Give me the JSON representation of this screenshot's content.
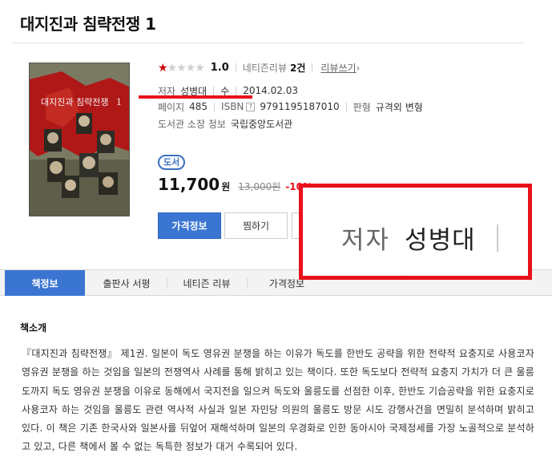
{
  "book": {
    "title": "대지진과 침략전쟁 1"
  },
  "rating": {
    "score": "1.0",
    "stars_filled_fraction": 0.1,
    "review_label": "네티즌리뷰",
    "review_count": "2건",
    "review_write": "리뷰쓰기",
    "chevron": "›"
  },
  "details": {
    "author_label": "저자",
    "author": "성병대",
    "role": "수",
    "date": "2014.02.03",
    "page_label": "페이지",
    "pages": "485",
    "isbn_label": "ISBN",
    "isbn_help": "?",
    "isbn": "9791195187010",
    "format_label": "판형",
    "format": "규격외 변형",
    "library_label": "도서관 소장 정보",
    "library": "국립중앙도서관"
  },
  "price": {
    "badge": "도서",
    "amount": "11,700",
    "won": "원",
    "original": "13,000원",
    "discount": "-10%"
  },
  "buttons": {
    "price_info": "가격정보",
    "wishlist": "찜하기"
  },
  "zoom": {
    "label": "저자",
    "value": "성병대",
    "next_line": "페이지 485"
  },
  "tabs": [
    {
      "label": "책정보"
    },
    {
      "label": "출판사 서평"
    },
    {
      "label": "네티즌 리뷰"
    },
    {
      "label": "가격정보"
    }
  ],
  "section": {
    "title": "책소개",
    "body": "『대지진과 침략전쟁』 제1권. 일본이 독도 영유권 분쟁을 하는 이유가 독도를 한반도 공략을 위한 전략적 요충지로 사용코자 영유권 분쟁을 하는 것임을 일본의 전쟁역사 사례를 통해 밝히고 있는 책이다. 또한 독도보다 전략적 요충지 가치가 더 큰 울릉도까지 독도 영유권 분쟁을 이유로 동해에서 국지전을 일으켜 독도와 울릉도를 선점한 이후, 한반도 기습공략을 위한 요충지로 사용코자 하는 것임을 울릉도 관련 역사적 사실과 일본 자민당 의원의 울릉도 방문 시도 강행사건을 면밀히 분석하며 밝히고 있다. 이 책은 기존 한국사와 일본사를 뒤엎어 재해석하며 일본의 우경화로 인한 동아시아 국제정세를 가장 노골적으로 분석하고 있고, 다른 책에서 볼 수 없는 독특한 정보가 대거 수록되어 있다."
  },
  "colors": {
    "accent_blue": "#3a75d2",
    "highlight_red": "#e8111b"
  },
  "cover": {
    "title_text": "대지진과 침략전쟁",
    "volume": "1"
  }
}
